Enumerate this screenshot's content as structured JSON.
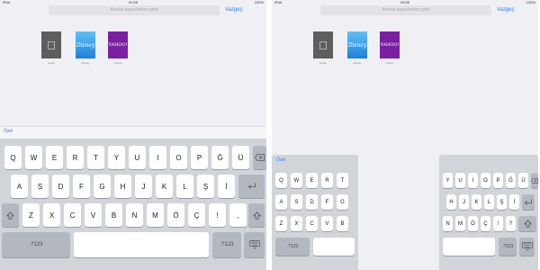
{
  "status_bar": {
    "left": "iPad",
    "center": "09:56",
    "right": "100%"
  },
  "nav": {
    "url_placeholder": "Arama yapın/adres girin",
    "cancel_label": "Vazgeç"
  },
  "favorites": [
    {
      "name": "Apple",
      "tile": "",
      "color": "#5e5e60"
    },
    {
      "name": "Disney",
      "tile": "Disney",
      "color": "#2b8fe6"
    },
    {
      "name": "Yahoo!",
      "tile": "YAHOO!",
      "color": "#7b1ea2"
    }
  ],
  "keyboard_bar_label": "Özel",
  "keyboard": {
    "row1": [
      "Q",
      "W",
      "E",
      "R",
      "T",
      "Y",
      "U",
      "I",
      "O",
      "P",
      "Ğ",
      "Ü"
    ],
    "row2": [
      "A",
      "S",
      "D",
      "F",
      "G",
      "H",
      "J",
      "K",
      "L",
      "Ş",
      "İ"
    ],
    "row3": [
      "Z",
      "X",
      "C",
      "V",
      "B",
      "N",
      "M",
      "Ö",
      "Ç",
      "!",
      ","
    ],
    "row3_alt": [
      "?",
      "."
    ],
    "numbers_label": ".?123",
    "backspace_icon": "backspace-icon",
    "return_icon": "return-icon",
    "shift_icon": "shift-icon",
    "dismiss_icon": "keyboard-dismiss-icon"
  },
  "split_keyboard": {
    "left_row1": [
      "Q",
      "W",
      "E",
      "R",
      "T"
    ],
    "left_row2": [
      "A",
      "S",
      "D",
      "F",
      "G"
    ],
    "left_row3": [
      "Z",
      "X",
      "C",
      "V",
      "B"
    ],
    "right_row1": [
      "Y",
      "U",
      "I",
      "O",
      "P",
      "Ğ",
      "Ü"
    ],
    "right_row2": [
      "H",
      "J",
      "K",
      "L",
      "Ş",
      "İ"
    ],
    "right_row3": [
      "N",
      "M",
      "Ö",
      "Ç",
      "!",
      "?"
    ]
  },
  "colors": {
    "accent": "#2f7ff6",
    "keyboard_bg": "#d1d4d9",
    "key_bg": "#ffffff",
    "dark_key_bg": "#b3b8c0"
  }
}
